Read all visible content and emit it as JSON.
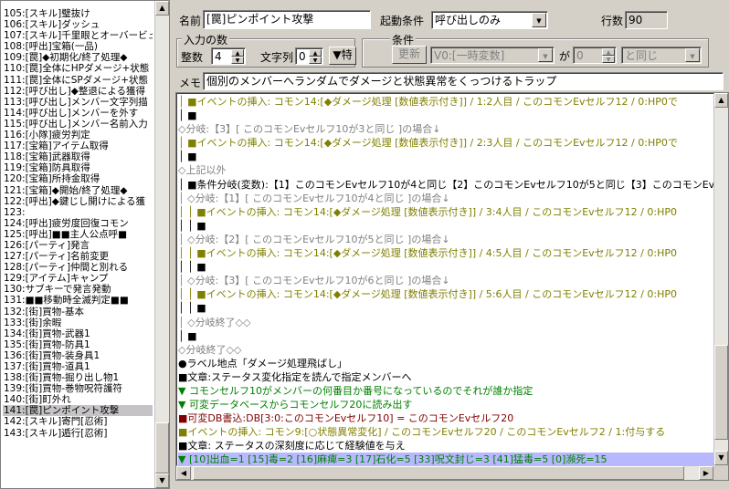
{
  "left_list": {
    "items": [
      "105:[スキル]璧抜け",
      "106:[スキル]ダッシュ",
      "107:[スキル]千里眼とオーバービュ",
      "108:[呼出]宝箱(一品)",
      "109:[罠]◆初期化/終了処理◆",
      "110:[罠]全体にHPダメージ+状態",
      "111:[罠]全体にSPダメージ+状態",
      "112:[呼び出し]◆整退による獲得",
      "113:[呼び出し]メンバー文字列描",
      "114:[呼び出し]メンバーを外す",
      "115:[呼び出し]メンバー名前入力",
      "116:[小隊]疲労判定",
      "117:[宝箱]アイテム取得",
      "118:[宝箱]武器取得",
      "119:[宝箱]防具取得",
      "120:[宝箱]所持金取得",
      "121:[宝箱]◆開始/終了処理◆",
      "122:[呼出]◆鍵じし開けによる獲",
      "123:",
      "124:[呼出]疲労度回復コモン",
      "125:[呼出]■■主人公点呼■",
      "126:[パーティ]発言",
      "127:[パーティ]名前変更",
      "128:[パーティ]仲間と別れる",
      "129:[アイテム]キャンプ",
      "130:サブキーで発言発動",
      "131:■■移動時全滅判定■■",
      "132:[街]買物-基本",
      "133:[街]余暇",
      "134:[街]買物-武器1",
      "135:[街]買物-防具1",
      "136:[街]買物-装身具1",
      "137:[街]買物-道具1",
      "138:[街]買物-掘り出し物1",
      "139:[街]買物-巻物呪符護符",
      "140:[街]町外れ",
      "141:[罠]ピンポイント攻撃",
      "142:[スキル]寄門[忍術]",
      "143:[スキル]遁行[忍術]"
    ],
    "selected_index": 36
  },
  "form": {
    "name_label": "名前",
    "name_value": "[罠]ピンポイント攻撃",
    "trigger_label": "起動条件",
    "trigger_value": "呼び出しのみ",
    "lines_label": "行数",
    "lines_value": "90",
    "inputs_group": "入力の数",
    "int_label": "整数",
    "int_value": "4",
    "str_label": "文字列",
    "str_value": "0",
    "toggle_label": "▼特",
    "cond_group": "条件",
    "update_label": "更新",
    "cond_var": "V0:[一時変数]",
    "cond_ga": "が",
    "cond_num": "0",
    "cond_op": "と同じ",
    "memo_label": "メモ",
    "memo_value": "個別のメンバーへランダムでダメージと状態異常をくっつけるトラップ"
  },
  "events": {
    "lines": [
      {
        "c": "olive",
        "t": "│ ■イベントの挿入: コモン14:[◆ダメージ処理 [数値表示付き]] / 1:2人目 / このコモンEvセルフ12 / 0:HP0で"
      },
      {
        "c": "black",
        "t": "│ ■"
      },
      {
        "c": "gray",
        "t": "◇分岐:【3】[ このコモンEvセルフ10が3と同じ ]の場合↓"
      },
      {
        "c": "olive",
        "t": "│ ■イベントの挿入: コモン14:[◆ダメージ処理 [数値表示付き]] / 2:3人目 / このコモンEvセルフ12 / 0:HP0で"
      },
      {
        "c": "black",
        "t": "│ ■"
      },
      {
        "c": "gray",
        "t": "◇上記以外"
      },
      {
        "c": "black",
        "t": "│ ■条件分岐(変数):【1】このコモンEvセルフ10が4と同じ【2】このコモンEvセルフ10が5と同じ【3】このコモンEvセルフ10が"
      },
      {
        "c": "gray",
        "t": "│ ◇分岐:【1】[ このコモンEvセルフ10が4と同じ ]の場合↓"
      },
      {
        "c": "olive",
        "t": "│ │ ■イベントの挿入: コモン14:[◆ダメージ処理 [数値表示付き]] / 3:4人目 / このコモンEvセルフ12 / 0:HP0"
      },
      {
        "c": "black",
        "t": "│ │ ■"
      },
      {
        "c": "gray",
        "t": "│ ◇分岐:【2】[ このコモンEvセルフ10が5と同じ ]の場合↓"
      },
      {
        "c": "olive",
        "t": "│ │ ■イベントの挿入: コモン14:[◆ダメージ処理 [数値表示付き]] / 4:5人目 / このコモンEvセルフ12 / 0:HP0"
      },
      {
        "c": "black",
        "t": "│ │ ■"
      },
      {
        "c": "gray",
        "t": "│ ◇分岐:【3】[ このコモンEvセルフ10が6と同じ ]の場合↓"
      },
      {
        "c": "olive",
        "t": "│ │ ■イベントの挿入: コモン14:[◆ダメージ処理 [数値表示付き]] / 5:6人目 / このコモンEvセルフ12 / 0:HP0"
      },
      {
        "c": "black",
        "t": "│ │ ■"
      },
      {
        "c": "gray",
        "t": "│ ◇分岐終了◇◇"
      },
      {
        "c": "black",
        "t": "│ ■"
      },
      {
        "c": "gray",
        "t": "◇分岐終了◇◇"
      },
      {
        "c": "black",
        "t": "●ラベル地点「ダメージ処理飛ばし」"
      },
      {
        "c": "black",
        "t": "■文章:ステータス変化指定を読んで指定メンバーへ"
      },
      {
        "c": "green",
        "t": "▼ コモンセルフ10がメンバーの何番目か番号になっているのでそれが誰か指定"
      },
      {
        "c": "green",
        "t": "▼ 可変データベースからコモンセルフ20に読み出す"
      },
      {
        "c": "red",
        "t": "■可変DB書込:DB[3:0:このコモンEvセルフ10] = このコモンEvセルフ20"
      },
      {
        "c": "olive",
        "t": "■イベントの挿入: コモン9:[○状態異常変化] / このコモンEvセルフ20 / このコモンEvセルフ2 / 1:付与する"
      },
      {
        "c": "black",
        "t": "■文章:  ステータスの深刻度に応じて経験値を与え"
      },
      {
        "c": "green",
        "t": "▼ [10]出血=1 [15]毒=2 [16]麻痺=3 [17]石化=5 [33]呪文封じ=3 [41]猛毒=5 [0]瀕死=15",
        "hl": true
      },
      {
        "c": "black",
        "t": "■"
      }
    ]
  },
  "colors": {
    "olive": "#808000",
    "gray": "#808080",
    "green": "#008000",
    "red": "#800000",
    "highlight": "#b8b8ff"
  }
}
